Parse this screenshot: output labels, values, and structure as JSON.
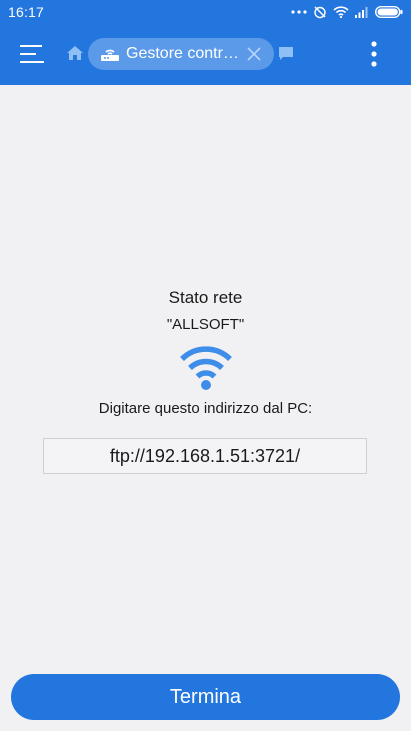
{
  "status_bar": {
    "time": "16:17",
    "icons": [
      "more-dots-icon",
      "alarm-off-icon",
      "wifi-icon",
      "signal-icon",
      "battery-icon"
    ]
  },
  "app_bar": {
    "tab_label": "Gestore contr…",
    "icons": [
      "hamburger-menu-icon",
      "home-icon",
      "router-icon",
      "close-icon",
      "chat-icon",
      "more-vertical-icon"
    ]
  },
  "main": {
    "network_title": "Stato rete",
    "network_name": "\"ALLSOFT\"",
    "instruction": "Digitare questo indirizzo dal PC:",
    "address": "ftp://192.168.1.51:3721/",
    "stop_label": "Termina"
  },
  "colors": {
    "accent": "#2476df",
    "background": "#f1f1f3",
    "wifi": "#3e8de8"
  }
}
